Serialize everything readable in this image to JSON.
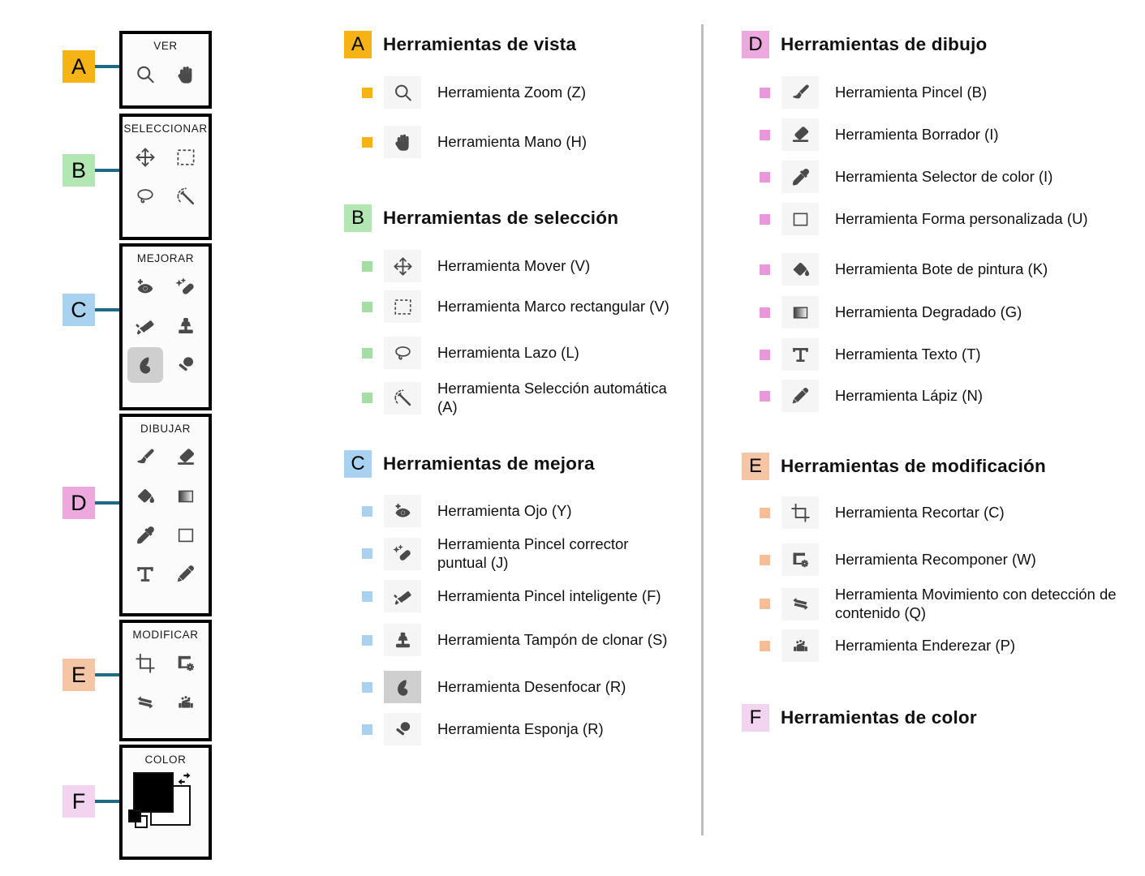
{
  "toolbar": {
    "sections": [
      {
        "key": "A",
        "title": "VER",
        "tools": [
          "zoom-icon",
          "hand-icon"
        ]
      },
      {
        "key": "B",
        "title": "SELECCIONAR",
        "tools": [
          "move-icon",
          "marquee-icon",
          "lasso-icon",
          "magic-wand-icon"
        ]
      },
      {
        "key": "C",
        "title": "MEJORAR",
        "tools": [
          "red-eye-icon",
          "spot-healing-icon",
          "smart-brush-icon",
          "clone-stamp-icon",
          "blur-icon",
          "sponge-icon"
        ]
      },
      {
        "key": "D",
        "title": "DIBUJAR",
        "tools": [
          "brush-icon",
          "eraser-icon",
          "paint-bucket-icon",
          "gradient-icon",
          "eyedropper-icon",
          "shape-icon",
          "type-icon",
          "pencil-icon"
        ]
      },
      {
        "key": "E",
        "title": "MODIFICAR",
        "tools": [
          "crop-icon",
          "recompose-icon",
          "content-aware-move-icon",
          "straighten-icon"
        ]
      },
      {
        "key": "F",
        "title": "COLOR",
        "tools": [
          "color-swatches"
        ]
      }
    ]
  },
  "callouts": [
    {
      "letter": "A",
      "color": "#f5b315"
    },
    {
      "letter": "B",
      "color": "#b2e6b2"
    },
    {
      "letter": "C",
      "color": "#a8d2f0"
    },
    {
      "letter": "D",
      "color": "#eda9de"
    },
    {
      "letter": "E",
      "color": "#f5c6a5"
    },
    {
      "letter": "F",
      "color": "#f2d3f0"
    }
  ],
  "groups": [
    {
      "letter": "A",
      "color": "#f5b315",
      "bullet": "#f5b315",
      "title": "Herramientas de vista",
      "items": [
        {
          "icon": "zoom-icon",
          "label": "Herramienta Zoom (Z)"
        },
        {
          "icon": "hand-icon",
          "label": "Herramienta Mano (H)"
        }
      ]
    },
    {
      "letter": "B",
      "color": "#b2e6b2",
      "bullet": "#a3dfa3",
      "title": "Herramientas de selección",
      "items": [
        {
          "icon": "move-icon",
          "label": "Herramienta Mover (V)"
        },
        {
          "icon": "marquee-icon",
          "label": "Herramienta Marco rectangular (V)"
        },
        {
          "icon": "lasso-icon",
          "label": "Herramienta Lazo (L)"
        },
        {
          "icon": "magic-wand-icon",
          "label": "Herramienta Selección automática (A)"
        }
      ]
    },
    {
      "letter": "C",
      "color": "#a8d2f0",
      "bullet": "#a8d2f0",
      "title": "Herramientas de mejora",
      "items": [
        {
          "icon": "red-eye-icon",
          "label": "Herramienta Ojo (Y)"
        },
        {
          "icon": "spot-healing-icon",
          "label": "Herramienta Pincel corrector puntual (J)"
        },
        {
          "icon": "smart-brush-icon",
          "label": "Herramienta Pincel inteligente (F)"
        },
        {
          "icon": "clone-stamp-icon",
          "label": "Herramienta Tampón de clonar (S)"
        },
        {
          "icon": "blur-icon",
          "label": "Herramienta Desenfocar (R)",
          "selected": true
        },
        {
          "icon": "sponge-icon",
          "label": "Herramienta Esponja (R)"
        }
      ]
    },
    {
      "letter": "D",
      "color": "#eda9de",
      "bullet": "#e79ad9",
      "title": "Herramientas de dibujo",
      "items": [
        {
          "icon": "brush-icon",
          "label": "Herramienta Pincel (B)"
        },
        {
          "icon": "eraser-icon",
          "label": "Herramienta Borrador (I)"
        },
        {
          "icon": "eyedropper-icon",
          "label": "Herramienta Selector de color (I)"
        },
        {
          "icon": "shape-icon",
          "label": "Herramienta Forma personalizada (U)"
        },
        {
          "icon": "paint-bucket-icon",
          "label": "Herramienta Bote de pintura (K)"
        },
        {
          "icon": "gradient-icon",
          "label": "Herramienta Degradado (G)"
        },
        {
          "icon": "type-icon",
          "label": "Herramienta Texto (T)"
        },
        {
          "icon": "pencil-icon",
          "label": "Herramienta Lápiz (N)"
        }
      ]
    },
    {
      "letter": "E",
      "color": "#f5c6a5",
      "bullet": "#f5bd98",
      "title": "Herramientas de modificación",
      "items": [
        {
          "icon": "crop-icon",
          "label": "Herramienta Recortar (C)"
        },
        {
          "icon": "recompose-icon",
          "label": "Herramienta Recomponer (W)"
        },
        {
          "icon": "content-aware-move-icon",
          "label": "Herramienta Movimiento con detección de contenido (Q)"
        },
        {
          "icon": "straighten-icon",
          "label": "Herramienta Enderezar (P)"
        }
      ]
    },
    {
      "letter": "F",
      "color": "#f2d3f0",
      "bullet": "#f2d3f0",
      "title": "Herramientas de color",
      "items": []
    }
  ],
  "colors": {
    "leader_line": "#1f6a86",
    "divider": "#bdbdbd",
    "panel_border": "#000000",
    "panel_bg": "#fbfbfb",
    "icon": "#4a4a4a",
    "selected_bg": "#cfcfcf"
  }
}
